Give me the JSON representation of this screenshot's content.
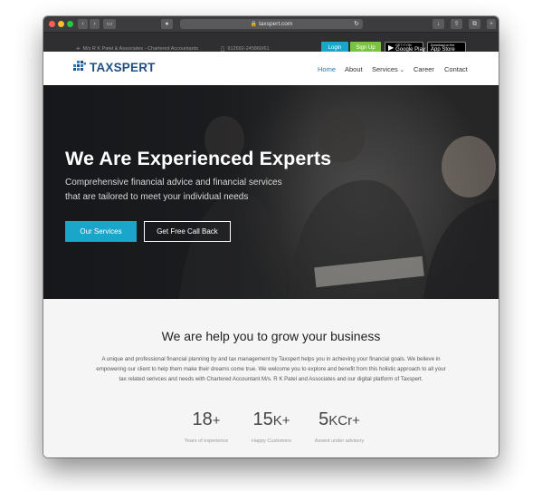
{
  "browser": {
    "url": "taxspert.com",
    "lock_icon": "lock-icon",
    "reload_icon": "reload-icon"
  },
  "topbar": {
    "company": "M/s R K Patel & Associates - Chartered Accountants",
    "phone": "912692-245860/61",
    "login_label": "Login",
    "signup_label": "Sign Up",
    "google_play_small": "GET IT ON",
    "google_play_label": "Google Play",
    "app_store_small": "Download on the",
    "app_store_label": "App Store"
  },
  "nav": {
    "logo_text": "TAXSPERT",
    "items": [
      {
        "label": "Home",
        "active": true
      },
      {
        "label": "About",
        "active": false
      },
      {
        "label": "Services",
        "active": false,
        "dropdown": true
      },
      {
        "label": "Career",
        "active": false
      },
      {
        "label": "Contact",
        "active": false
      }
    ]
  },
  "hero": {
    "title": "We Are Experienced Experts",
    "subtitle_line1": "Comprehensive financial advice and financial services",
    "subtitle_line2": "that are tailored to meet your individual needs",
    "primary_button": "Our Services",
    "secondary_button": "Get Free Call Back"
  },
  "intro": {
    "heading": "We are help you to grow your business",
    "paragraph": "A unique and professional financial planning by and tax management by Taxspert helps you in achieving your financial goals. We believe in empowering our client to help them make their dreams come true. We welcome you to explore and benefit from this holistic approach to all your tax related serivces and needs with Chartered Accountant M/s. R K Patel and Associates and our digital platform of Taxspert."
  },
  "stats": [
    {
      "number": "18",
      "unit": "+",
      "label": "Years of experience"
    },
    {
      "number": "15",
      "unit": "K+",
      "label": "Happy Customers"
    },
    {
      "number": "5",
      "unit": "KCr+",
      "label": "Assent under advisory"
    }
  ],
  "colors": {
    "accent_teal": "#1aa6cb",
    "signup_green": "#7cc242",
    "logo_blue": "#1e4f86",
    "nav_active": "#2b78b8"
  }
}
